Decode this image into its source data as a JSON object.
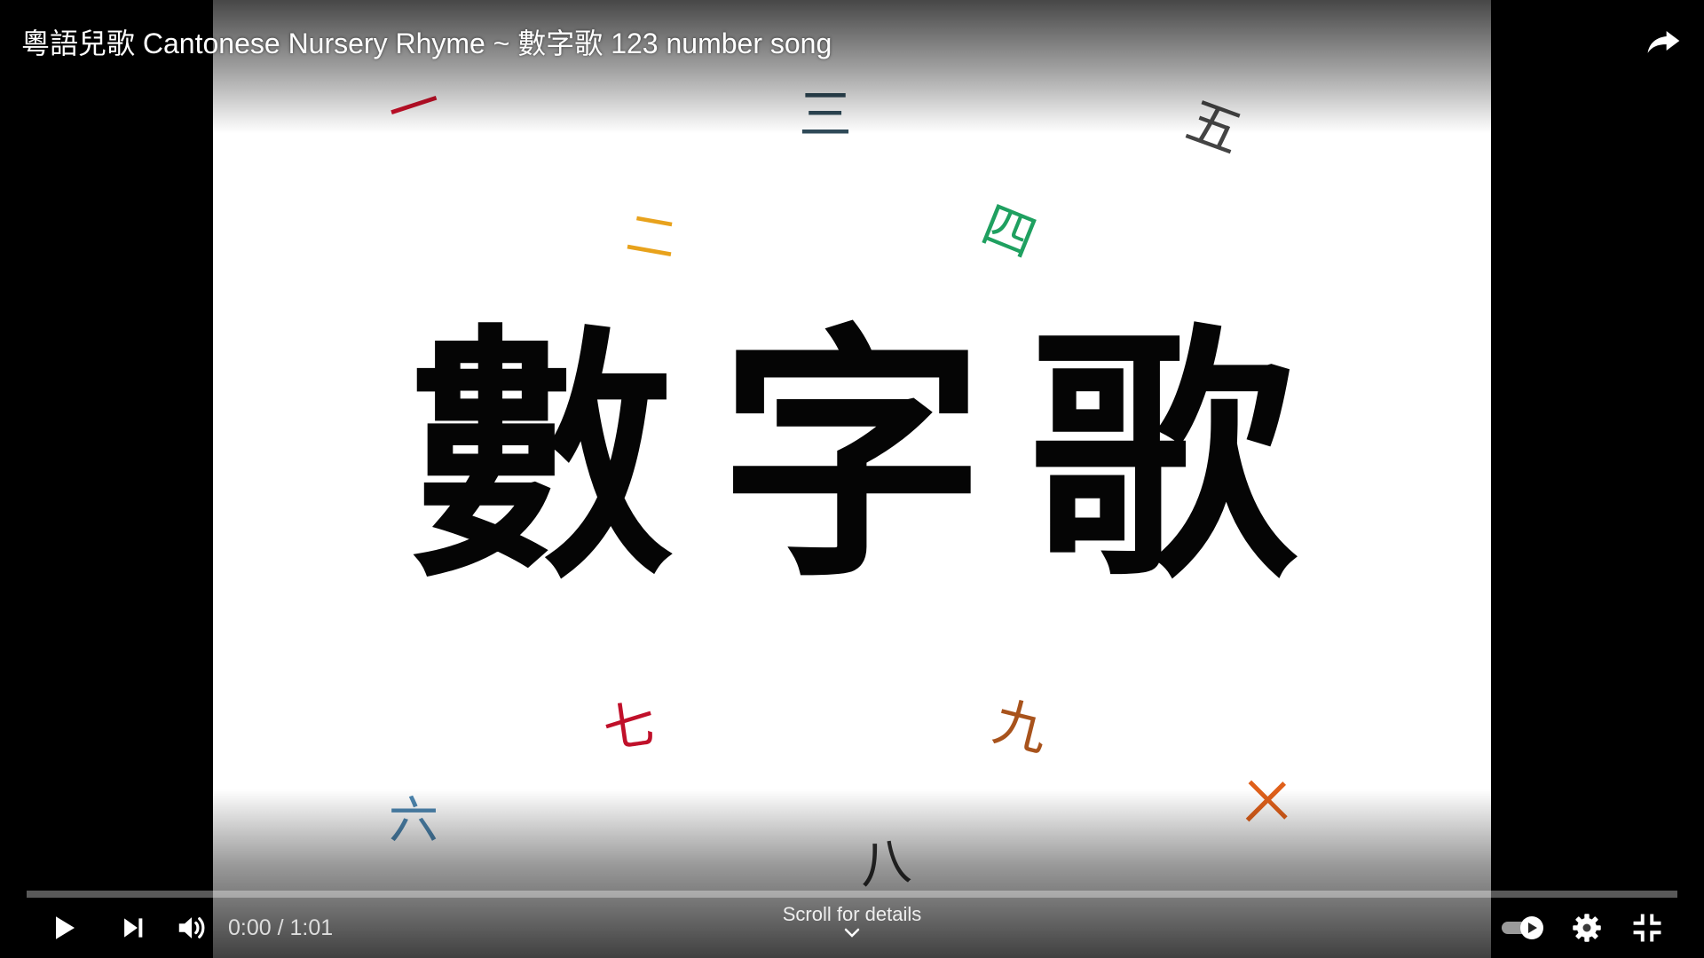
{
  "video": {
    "title": "粵語兒歌 Cantonese Nursery Rhyme ~ 數字歌 123 number song",
    "frame": {
      "big_title": [
        "數",
        "字",
        "歌"
      ],
      "numerals": [
        {
          "char": "一",
          "color": "#d0102a"
        },
        {
          "char": "二",
          "color": "#e8a21c"
        },
        {
          "char": "三",
          "color": "#2f4a58"
        },
        {
          "char": "四",
          "color": "#1fa060"
        },
        {
          "char": "五",
          "color": "#444444"
        },
        {
          "char": "六",
          "color": "#4d86b0"
        },
        {
          "char": "七",
          "color": "#c0102a"
        },
        {
          "char": "八",
          "color": "#333333"
        },
        {
          "char": "九",
          "color": "#a8531c"
        },
        {
          "char": "十",
          "color": "#e0601a"
        }
      ]
    }
  },
  "player": {
    "time": "0:00 / 1:01",
    "scroll_hint": "Scroll for details",
    "progress_fraction": 0,
    "autoplay_enabled": true
  },
  "icons": {
    "share": "share-icon",
    "play": "play-icon",
    "next": "next-icon",
    "volume": "volume-icon",
    "autoplay": "autoplay-toggle-icon",
    "settings": "gear-icon",
    "exit_fullscreen": "exit-fullscreen-icon",
    "scroll_chevron": "chevron-down-icon"
  },
  "colors": {
    "progress_fill": "#ff0000",
    "text": "#ffffff"
  }
}
